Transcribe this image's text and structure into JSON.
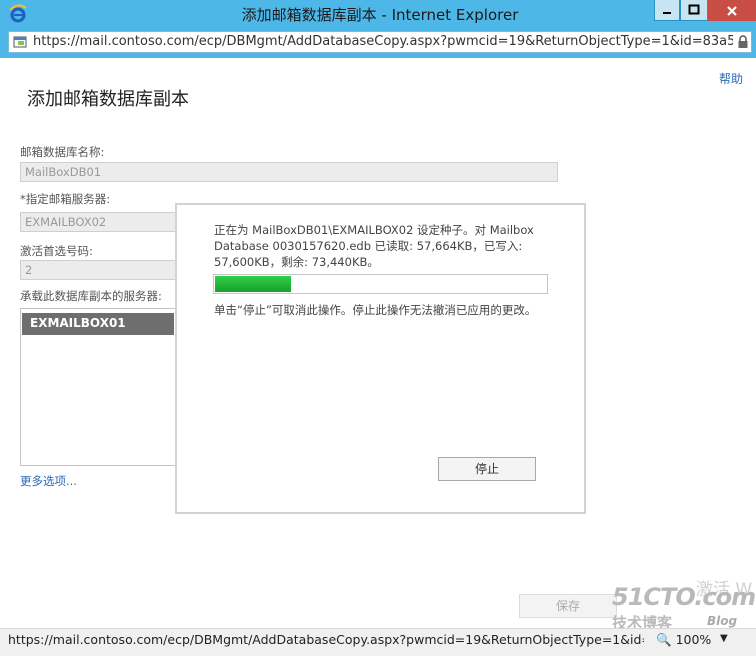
{
  "window": {
    "title": "添加邮箱数据库副本 - Internet Explorer",
    "controls": {
      "minimize": "—",
      "maximize": "□",
      "close": "✕"
    }
  },
  "address_bar": {
    "url": "https://mail.contoso.com/ecp/DBMgmt/AddDatabaseCopy.aspx?pwmcid=19&ReturnObjectType=1&id=83a59288-75fb-"
  },
  "page": {
    "help_link": "帮助",
    "title": "添加邮箱数据库副本",
    "fields": {
      "db_name_label": "邮箱数据库名称:",
      "db_name_value": "MailBoxDB01",
      "server_label": "*指定邮箱服务器:",
      "server_value": "EXMAILBOX02",
      "activation_label": "激活首选号码:",
      "activation_value": "2",
      "hosting_label": "承载此数据库副本的服务器:"
    },
    "server_list": [
      "EXMAILBOX01"
    ],
    "more_options": "更多选项...",
    "save_button": "保存"
  },
  "dialog": {
    "progress_text": "正在为 MailBoxDB01\\EXMAILBOX02 设定种子。对 Mailbox Database 0030157620.edb 已读取: 57,664KB，已写入: 57,600KB，剩余: 73,440KB。",
    "progress_fraction": 0.23,
    "note": "单击“停止”可取消此操作。停止此操作无法撤消已应用的更改。",
    "stop_button": "停止"
  },
  "status_bar": {
    "url": "https://mail.contoso.com/ecp/DBMgmt/AddDatabaseCopy.aspx?pwmcid=19&ReturnObjectType=1&id=83a5",
    "zoom": "100%"
  },
  "watermark": {
    "activate": "激活 W",
    "site": "51CTO.com",
    "tagline": "技术博客",
    "blog": "Blog"
  },
  "colors": {
    "titlebar": "#4db8e8",
    "close": "#c74d45",
    "progress": "#22b33a",
    "link": "#2b6bb5"
  }
}
